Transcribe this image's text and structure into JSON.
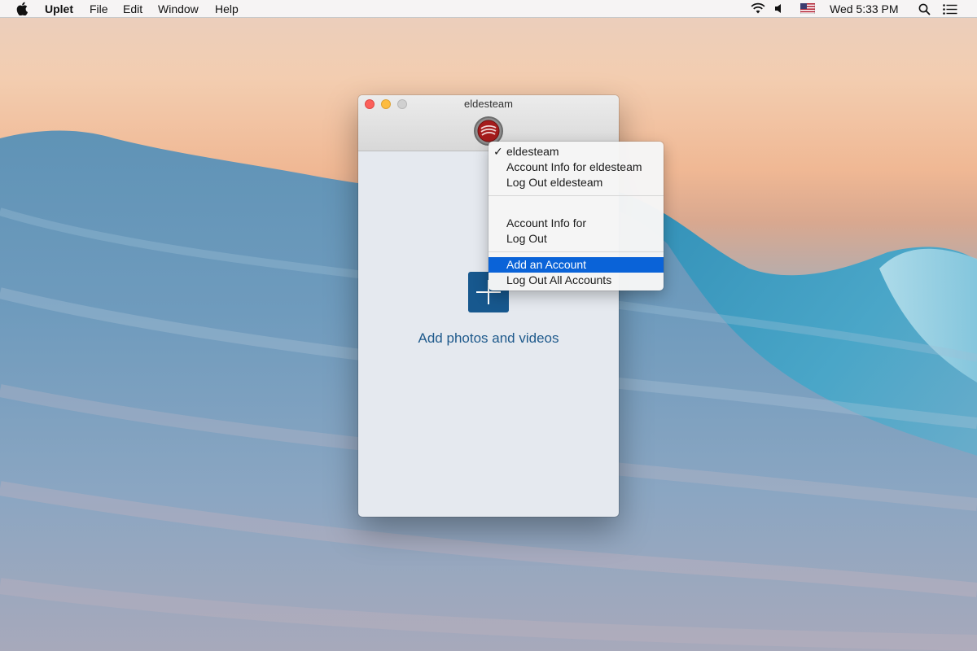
{
  "menubar": {
    "app_name": "Uplet",
    "items": [
      "File",
      "Edit",
      "Window",
      "Help"
    ],
    "clock": "Wed 5:33 PM",
    "icons": [
      "apple-icon",
      "wifi-icon",
      "volume-icon",
      "us-flag-icon",
      "spotlight-search-icon",
      "notification-center-icon"
    ]
  },
  "window": {
    "title": "eldesteam",
    "add_label": "Add photos and videos"
  },
  "dropdown": {
    "current_account": "eldesteam",
    "account_info_current": "Account Info for eldesteam",
    "logout_current": "Log Out eldesteam",
    "account_info_other": "Account Info for",
    "logout_other": "Log Out",
    "add_account": "Add an Account",
    "logout_all": "Log Out All Accounts",
    "check_mark": "✓"
  },
  "colors": {
    "accent": "#17588e",
    "menu_highlight": "#0a63d8",
    "link_text": "#1f5a8c"
  }
}
